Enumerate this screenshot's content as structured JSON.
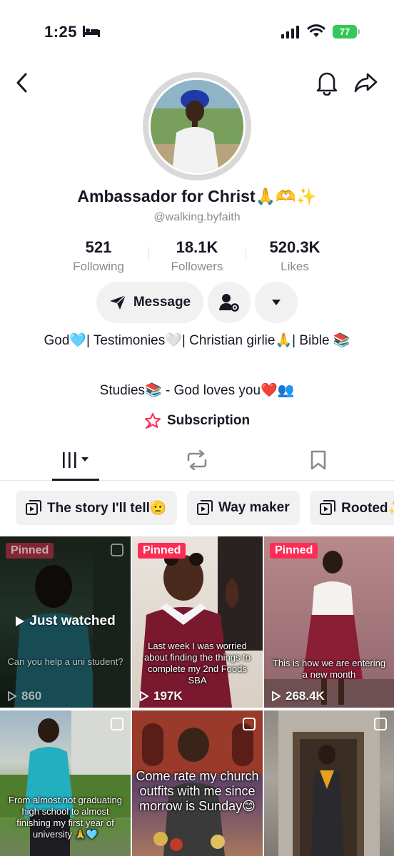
{
  "status_bar": {
    "time": "1:25",
    "battery": "77"
  },
  "profile": {
    "display_name": "Ambassador for Christ🙏🫶✨",
    "username": "@walking.byfaith",
    "stats": [
      {
        "value": "521",
        "label": "Following"
      },
      {
        "value": "18.1K",
        "label": "Followers"
      },
      {
        "value": "520.3K",
        "label": "Likes"
      }
    ],
    "message_label": "Message",
    "bio_line1": "God🩵| Testimonies🤍| Christian girlie🙏| Bible 📚",
    "bio_line2": "Studies📚 - God loves you❤️👥",
    "subscription_label": "Subscription"
  },
  "playlists": [
    {
      "label": "The story I'll tell🫡"
    },
    {
      "label": "Way maker"
    },
    {
      "label": "Rooted✨"
    }
  ],
  "videos": [
    {
      "pinned": "Pinned",
      "views": "860",
      "overlay": "Just watched",
      "caption": "Can you help a uni student?"
    },
    {
      "pinned": "Pinned",
      "views": "197K",
      "caption": "Last week I was worried about finding the things to complete my 2nd Foods SBA"
    },
    {
      "pinned": "Pinned",
      "views": "268.4K",
      "caption": "This is how we are entering a new month"
    },
    {
      "caption": "From almost not graduating high school to almost finishing my first year of university 🙏🩵"
    },
    {
      "caption": "Come rate my church outfits with me since morrow is Sunday😊"
    },
    {}
  ],
  "colors": {
    "accent": "#fe2c55",
    "battery": "#34c759",
    "secondary_text": "#8a8b91"
  }
}
